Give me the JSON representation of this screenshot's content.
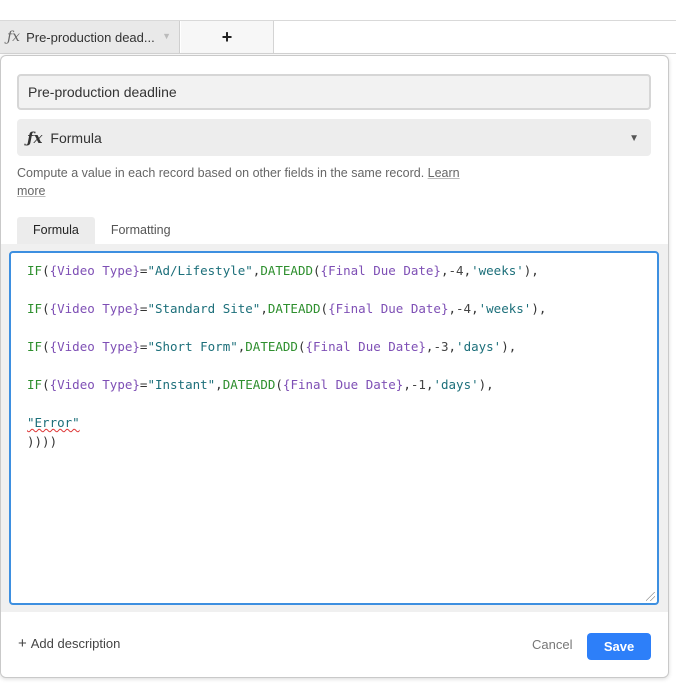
{
  "tab_strip": {
    "field_tab_label": "Pre-production dead...",
    "field_tab_icon": "fx-formula-icon",
    "add_tab_label": "+"
  },
  "dialog": {
    "field_name_value": "Pre-production deadline",
    "field_type_label": "Formula",
    "description_text": "Compute a value in each record based on other fields in the same record. ",
    "learn_more_label": "Learn more",
    "tabs": [
      {
        "label": "Formula",
        "active": true
      },
      {
        "label": "Formatting",
        "active": false
      }
    ],
    "formula_lines": [
      "IF({Video Type}=\"Ad/Lifestyle\",DATEADD({Final Due Date},-4,'weeks'),",
      "IF({Video Type}=\"Standard Site\",DATEADD({Final Due Date},-4,'weeks'),",
      "IF({Video Type}=\"Short Form\",DATEADD({Final Due Date},-3,'days'),",
      "IF({Video Type}=\"Instant\",DATEADD({Final Due Date},-1,'days'),",
      "\"Error\"",
      "))))"
    ],
    "add_description_label": "Add description",
    "cancel_label": "Cancel",
    "save_label": "Save"
  },
  "colors": {
    "accent": "#2d7ff9",
    "editor_border": "#3d8fe0",
    "function": "#2e8f2e",
    "field_ref": "#7e4fb5",
    "string": "#1c6f7a"
  }
}
